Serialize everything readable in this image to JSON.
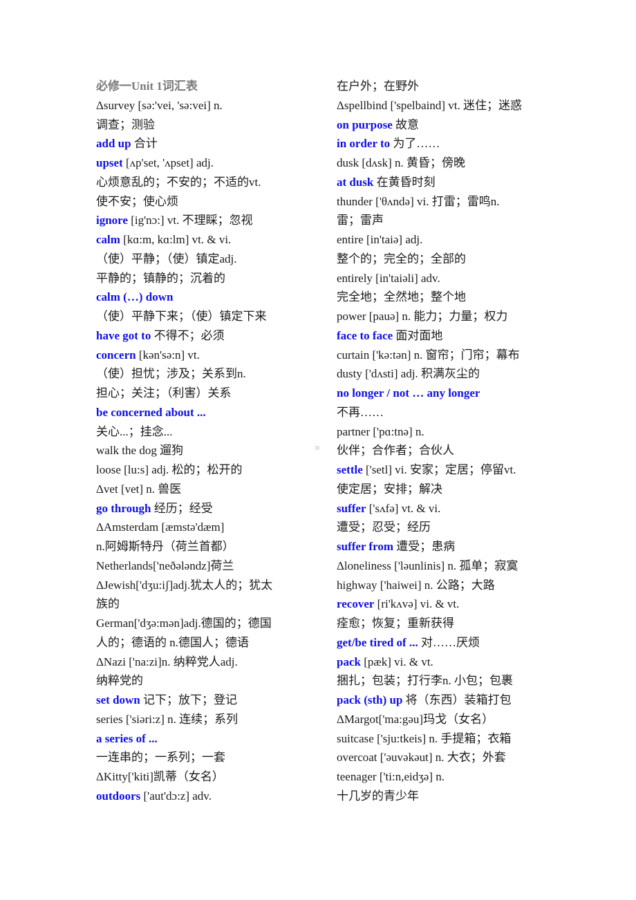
{
  "document": {
    "title": "必修一Unit 1词汇表",
    "left_column": [
      {
        "kw": "",
        "text": "Δsurvey [sə:'vei, 'sə:vei] n."
      },
      {
        "kw": "",
        "text": "调查；测验"
      },
      {
        "kw": "add up",
        "text": " 合计"
      },
      {
        "kw": "upset",
        "text": " [ʌp'set, 'ʌpset] adj."
      },
      {
        "kw": "",
        "text": "心烦意乱的；不安的；不适的vt."
      },
      {
        "kw": "",
        "text": "使不安；使心烦"
      },
      {
        "kw": "ignore",
        "text": " [ig'nɔ:] vt. 不理睬；忽视"
      },
      {
        "kw": "calm",
        "text": " [kɑ:m, kɑ:lm] vt. & vi."
      },
      {
        "kw": "",
        "text": "（使）平静；（使）镇定adj."
      },
      {
        "kw": "",
        "text": "平静的；镇静的；沉着的"
      },
      {
        "kw": "calm (…) down",
        "text": ""
      },
      {
        "kw": "",
        "text": "（使）平静下来；（使）镇定下来"
      },
      {
        "kw": "have got to",
        "text": " 不得不；必须"
      },
      {
        "kw": "concern",
        "text": " [kən'sə:n] vt."
      },
      {
        "kw": "",
        "text": "（使）担忧；涉及；关系到n."
      },
      {
        "kw": "",
        "text": "担心；关注；（利害）关系"
      },
      {
        "kw": "be concerned about ...",
        "text": ""
      },
      {
        "kw": "",
        "text": "关心...；挂念..."
      },
      {
        "kw": "",
        "text": "walk the dog 遛狗"
      },
      {
        "kw": "",
        "text": "loose [lu:s] adj. 松的；松开的"
      },
      {
        "kw": "",
        "text": "Δvet [vet] n. 兽医"
      },
      {
        "kw": "go through",
        "text": " 经历；经受"
      },
      {
        "kw": "",
        "text": "ΔAmsterdam [æmstə'dæm]"
      },
      {
        "kw": "",
        "text": "n.阿姆斯特丹（荷兰首都）"
      },
      {
        "kw": "",
        "text": "Netherlands['neðələndz]荷兰"
      },
      {
        "kw": "",
        "text": "ΔJewish['dʒu:iʃ]adj.犹太人的；犹太"
      },
      {
        "kw": "",
        "text": "族的"
      },
      {
        "kw": "",
        "text": "German['dʒə:mən]adj.德国的；德国"
      },
      {
        "kw": "",
        "text": "人的；德语的 n.德国人；德语"
      },
      {
        "kw": "",
        "text": "ΔNazi ['na:zi]n. 纳粹党人adj."
      },
      {
        "kw": "",
        "text": "纳粹党的"
      },
      {
        "kw": "set down",
        "text": " 记下；放下；登记"
      },
      {
        "kw": "",
        "text": "series ['siəri:z] n. 连续；系列"
      },
      {
        "kw": "a series of ...",
        "text": ""
      },
      {
        "kw": "",
        "text": "一连串的；一系列；一套"
      },
      {
        "kw": "",
        "text": "ΔKitty['kiti]凯蒂（女名）"
      },
      {
        "kw": "outdoors",
        "text": " ['aut'dɔ:z] adv."
      }
    ],
    "right_column": [
      {
        "kw": "",
        "text": "在户外；在野外"
      },
      {
        "kw": "",
        "text": "Δspellbind ['spelbaind] vt. 迷住；迷惑"
      },
      {
        "kw": "on purpose",
        "text": " 故意"
      },
      {
        "kw": "in order to",
        "text": " 为了……"
      },
      {
        "kw": "",
        "text": "dusk [dʌsk] n. 黄昏；傍晚"
      },
      {
        "kw": "at dusk",
        "text": " 在黄昏时刻"
      },
      {
        "kw": "",
        "text": "thunder ['θʌndə] vi. 打雷；雷鸣n."
      },
      {
        "kw": "",
        "text": "雷；雷声"
      },
      {
        "kw": "",
        "text": "entire [in'taiə] adj."
      },
      {
        "kw": "",
        "text": "整个的；完全的；全部的"
      },
      {
        "kw": "",
        "text": "entirely [in'taiəli] adv."
      },
      {
        "kw": "",
        "text": "完全地；全然地；整个地"
      },
      {
        "kw": "",
        "text": "power [pauə] n. 能力；力量；权力"
      },
      {
        "kw": "face to face",
        "text": " 面对面地"
      },
      {
        "kw": "",
        "text": "curtain ['kə:tən] n. 窗帘；门帘；幕布"
      },
      {
        "kw": "",
        "text": "dusty ['dʌsti] adj. 积满灰尘的"
      },
      {
        "kw": "no longer / not … any longer",
        "text": ""
      },
      {
        "kw": "",
        "text": "不再……"
      },
      {
        "kw": "",
        "text": "partner ['pɑ:tnə] n."
      },
      {
        "kw": "",
        "text": "伙伴；合作者；合伙人"
      },
      {
        "kw": "settle",
        "text": " ['setl] vi. 安家；定居；停留vt."
      },
      {
        "kw": "",
        "text": "使定居；安排；解决"
      },
      {
        "kw": "suffer",
        "text": " ['sʌfə] vt. & vi."
      },
      {
        "kw": "",
        "text": "遭受；忍受；经历"
      },
      {
        "kw": "suffer from",
        "text": " 遭受；患病"
      },
      {
        "kw": "",
        "text": "Δloneliness ['ləunlinis] n. 孤单；寂寞"
      },
      {
        "kw": "",
        "text": "highway ['haiwei] n. 公路；大路"
      },
      {
        "kw": "recover",
        "text": " [ri'kʌvə] vi. & vt."
      },
      {
        "kw": "",
        "text": "痊愈；恢复；重新获得"
      },
      {
        "kw": "get/be tired of ...",
        "text": " 对……厌烦"
      },
      {
        "kw": "pack",
        "text": " [pæk] vi. & vt."
      },
      {
        "kw": "",
        "text": "捆扎；包装；打行李n. 小包；包裹"
      },
      {
        "kw": "pack (sth) up",
        "text": " 将（东西）装箱打包"
      },
      {
        "kw": "",
        "text": "ΔMargot['ma:gəu]玛戈（女名）"
      },
      {
        "kw": "",
        "text": "suitcase ['sju:tkeis] n. 手提箱；衣箱"
      },
      {
        "kw": "",
        "text": "overcoat ['əuvəkəut] n. 大衣；外套"
      },
      {
        "kw": "",
        "text": "teenager ['ti:n,eidʒə] n."
      },
      {
        "kw": "",
        "text": "十几岁的青少年"
      }
    ]
  },
  "colors": {
    "keyword": "#1010e6",
    "title": "#7a7a7a",
    "body_text": "#1a1a1a"
  }
}
